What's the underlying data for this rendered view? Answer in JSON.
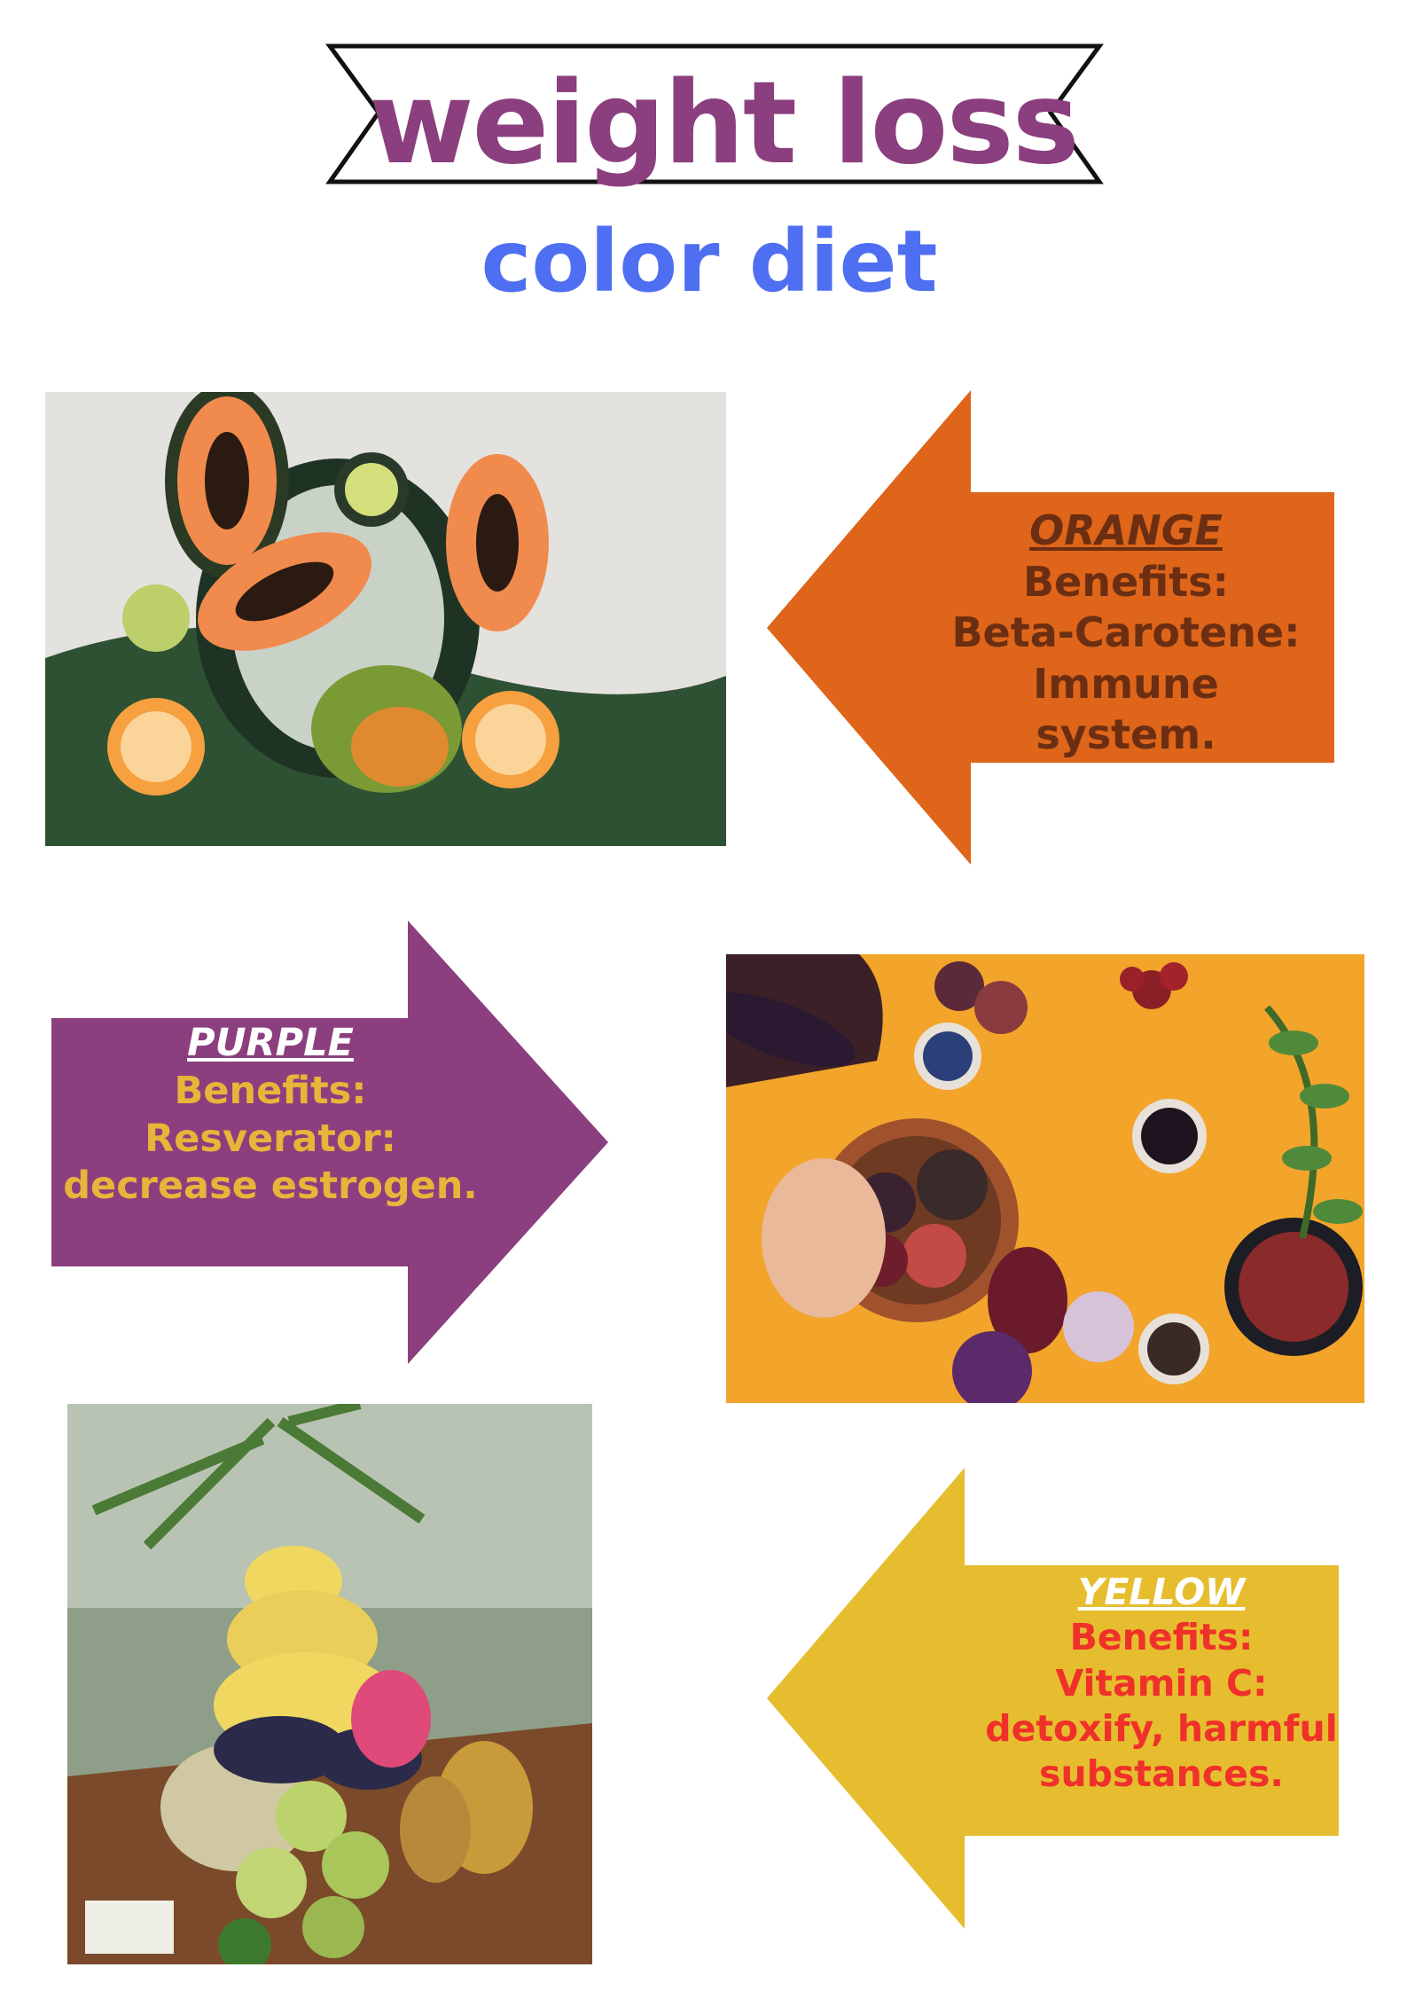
{
  "header": {
    "title": "weight loss",
    "subtitle": "color diet"
  },
  "colors": {
    "title": "#8b3f7e",
    "subtitle": "#4f6ff2",
    "orange_arrow": "#de6519",
    "orange_text": "#6b2e12",
    "purple_arrow": "#8b3f7e",
    "purple_text": "#e8b43a",
    "yellow_arrow": "#e6bd2e",
    "yellow_text": "#f0302a"
  },
  "sections": {
    "orange": {
      "heading": "ORANGE",
      "benefits_label": "Benefits:",
      "nutrient": "Beta-Carotene:",
      "effect": "Immune system."
    },
    "purple": {
      "heading": "PURPLE",
      "benefits_label": "Benefits:",
      "nutrient": "Resverator:",
      "effect": "decrease estrogen."
    },
    "yellow": {
      "heading": "YELLOW",
      "benefits_label": "Benefits:",
      "nutrient": "Vitamin C:",
      "effect_line1": "detoxify, harmful",
      "effect_line2": "substances."
    }
  }
}
